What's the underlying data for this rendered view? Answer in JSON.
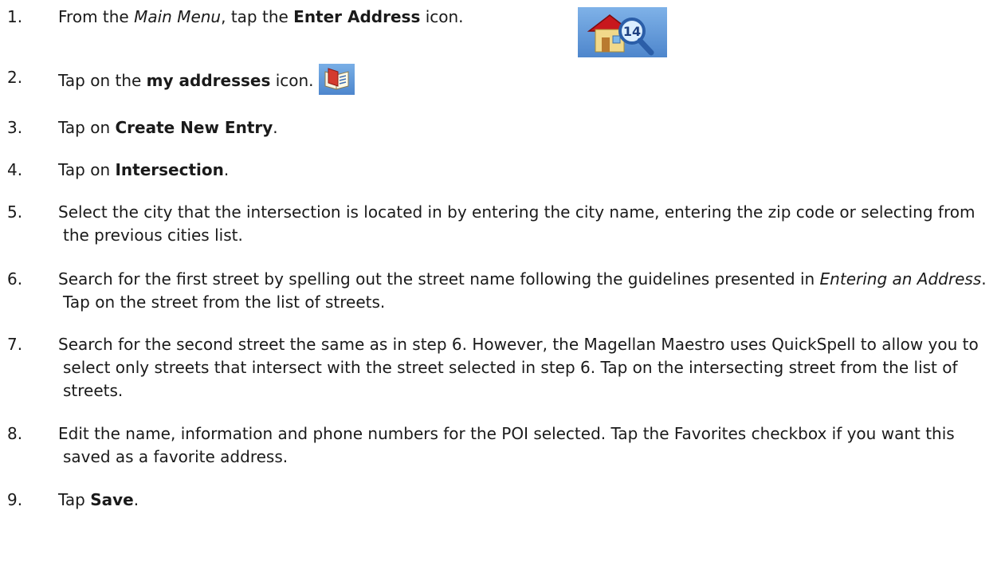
{
  "steps": [
    {
      "num": "1.",
      "parts": [
        {
          "t": "From the "
        },
        {
          "t": "Main Menu",
          "s": "i"
        },
        {
          "t": ", tap the "
        },
        {
          "t": "Enter Address",
          "s": "b"
        },
        {
          "t": " icon."
        }
      ]
    },
    {
      "num": "2.",
      "parts": [
        {
          "t": "Tap on the "
        },
        {
          "t": "my addresses",
          "s": "b"
        },
        {
          "t": " icon."
        }
      ]
    },
    {
      "num": "3.",
      "parts": [
        {
          "t": "Tap on "
        },
        {
          "t": "Create New Entry",
          "s": "b"
        },
        {
          "t": "."
        }
      ]
    },
    {
      "num": "4.",
      "parts": [
        {
          "t": "Tap on "
        },
        {
          "t": "Intersection",
          "s": "b"
        },
        {
          "t": "."
        }
      ]
    },
    {
      "num": "5.",
      "parts": [
        {
          "t": "Select the city that the intersection is located in by entering the city name, entering the zip code or selecting from the previous cities list."
        }
      ]
    },
    {
      "num": "6.",
      "parts": [
        {
          "t": "Search for the first street by spelling out the street name following the guidelines presented in "
        },
        {
          "t": "Entering an Address",
          "s": "i"
        },
        {
          "t": ".  Tap on the street from the list of streets."
        }
      ]
    },
    {
      "num": "7.",
      "parts": [
        {
          "t": "Search for the second street the same as in step 6.  However, the Magellan Maestro uses QuickSpell to allow you to select only streets that intersect with the street selected in step 6.  Tap on the intersecting street from the list of streets."
        }
      ]
    },
    {
      "num": "8.",
      "parts": [
        {
          "t": "Edit the name, information and phone numbers for the POI selected.  Tap the Favorites checkbox if you want this saved as a favorite address."
        }
      ]
    },
    {
      "num": "9.",
      "parts": [
        {
          "t": "Tap "
        },
        {
          "t": "Save",
          "s": "b"
        },
        {
          "t": "."
        }
      ]
    }
  ],
  "icons": {
    "enter_address_badge": "14",
    "enter_address_icon": "house-magnifier-icon",
    "my_addresses_icon": "address-book-icon"
  }
}
